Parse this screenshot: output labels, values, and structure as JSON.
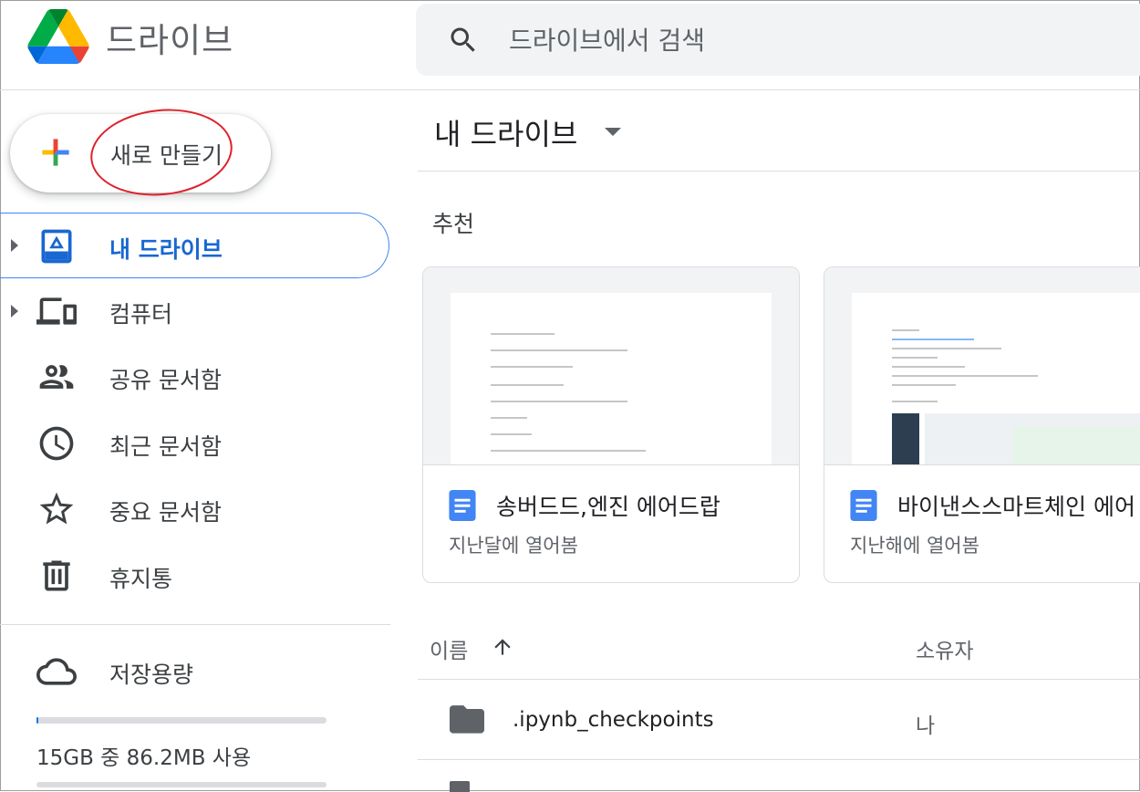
{
  "app": {
    "title": "드라이브"
  },
  "search": {
    "placeholder": "드라이브에서 검색"
  },
  "new_button": {
    "label": "새로 만들기"
  },
  "sidebar": {
    "items": [
      {
        "label": "내 드라이브",
        "icon": "drive-icon",
        "selected": true
      },
      {
        "label": "컴퓨터",
        "icon": "computer-icon"
      },
      {
        "label": "공유 문서함",
        "icon": "people-icon"
      },
      {
        "label": "최근 문서함",
        "icon": "clock-icon"
      },
      {
        "label": "중요 문서함",
        "icon": "star-icon"
      },
      {
        "label": "휴지통",
        "icon": "trash-icon"
      }
    ],
    "storage": {
      "label": "저장용량",
      "usage": "15GB 중 86.2MB 사용",
      "used_fraction": 0.006
    }
  },
  "main": {
    "title": "내 드라이브",
    "suggested_label": "추천",
    "cards": [
      {
        "title": "송버드드,엔진 에어드랍",
        "subtitle": "지난달에 열어봄"
      },
      {
        "title": "바이낸스스마트체인 에어",
        "subtitle": "지난해에 열어봄"
      }
    ],
    "columns": {
      "name": "이름",
      "owner": "소유자"
    },
    "rows": [
      {
        "name": ".ipynb_checkpoints",
        "owner": "나"
      }
    ]
  },
  "colors": {
    "accent": "#1a73e8",
    "selected_border": "#4285f4",
    "annotation": "#e0202a"
  }
}
